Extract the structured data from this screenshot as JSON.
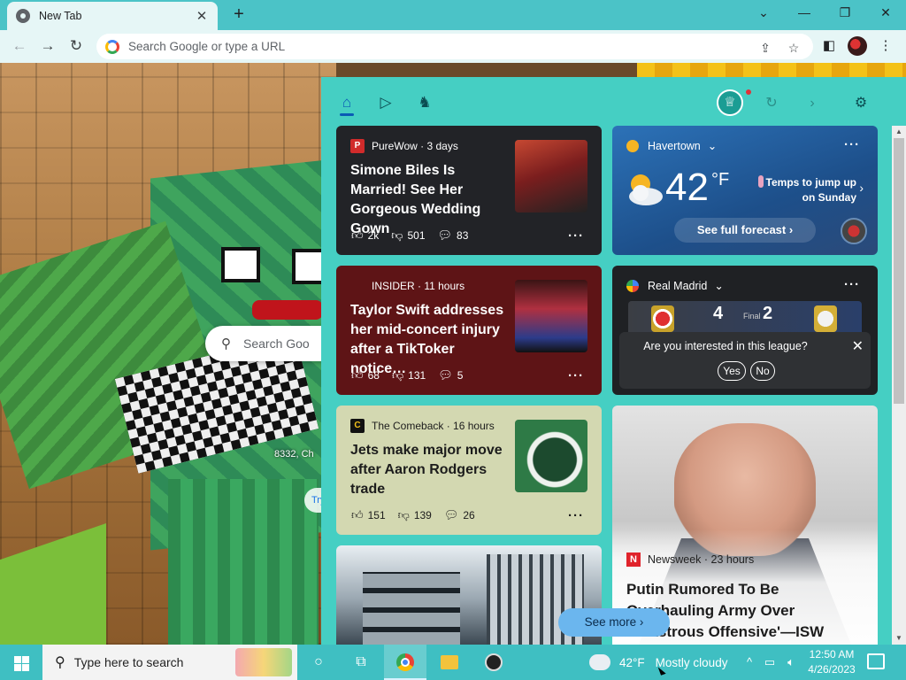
{
  "browser": {
    "tab_title": "New Tab",
    "tab_close": "✕",
    "new_tab": "+",
    "window_controls": {
      "dropdown": "⌄",
      "minimize": "—",
      "restore": "❐",
      "close": "✕"
    },
    "omnibox_placeholder": "Search Google or type a URL"
  },
  "page": {
    "search_placeholder": "Search Goo",
    "caption": "8332, Ch",
    "try_label": "Try"
  },
  "widgets": {
    "news": [
      {
        "source": "PureWow · 3 days",
        "logo_text": "P",
        "logo_color": "#d12b2b",
        "headline": "Simone Biles Is Married! See Her Gorgeous Wedding Gown",
        "likes": "2k",
        "dislikes": "501",
        "comments": "83"
      },
      {
        "source": "INSIDER · 11 hours",
        "logo_text": "",
        "logo_color": "#5e1416",
        "headline": "Taylor Swift addresses her mid-concert injury after a TikToker notice…",
        "likes": "68",
        "dislikes": "131",
        "comments": "5"
      },
      {
        "source": "The Comeback · 16 hours",
        "logo_text": "C",
        "logo_color": "#111111",
        "headline": "Jets make major move after Aaron Rodgers trade",
        "likes": "151",
        "dislikes": "139",
        "comments": "26"
      }
    ],
    "weather": {
      "location": "Havertown",
      "temp": "42",
      "unit": "°F",
      "note": "Temps to jump up on Sunday",
      "forecast_button": "See full forecast ›"
    },
    "sports": {
      "team": "Real Madrid",
      "home_score": "4",
      "away_score": "2",
      "status": "Final",
      "prompt": "Are you interested in this league?",
      "yes": "Yes",
      "no": "No"
    },
    "feature": {
      "source": "Newsweek · 23 hours",
      "logo_text": "N",
      "headline": "Putin Rumored To Be Overhauling Army Over Disastrous Offensive'—ISW"
    },
    "see_more": "See more ›",
    "more_dots": "···"
  },
  "taskbar": {
    "search_placeholder": "Type here to search",
    "weather_temp": "42°F",
    "weather_desc": "Mostly cloudy",
    "time": "12:50 AM",
    "date": "4/26/2023"
  },
  "colors": {
    "accent": "#45cfc3",
    "taskbar": "#3fbfc2",
    "weather_card": "#1d4f8a"
  }
}
